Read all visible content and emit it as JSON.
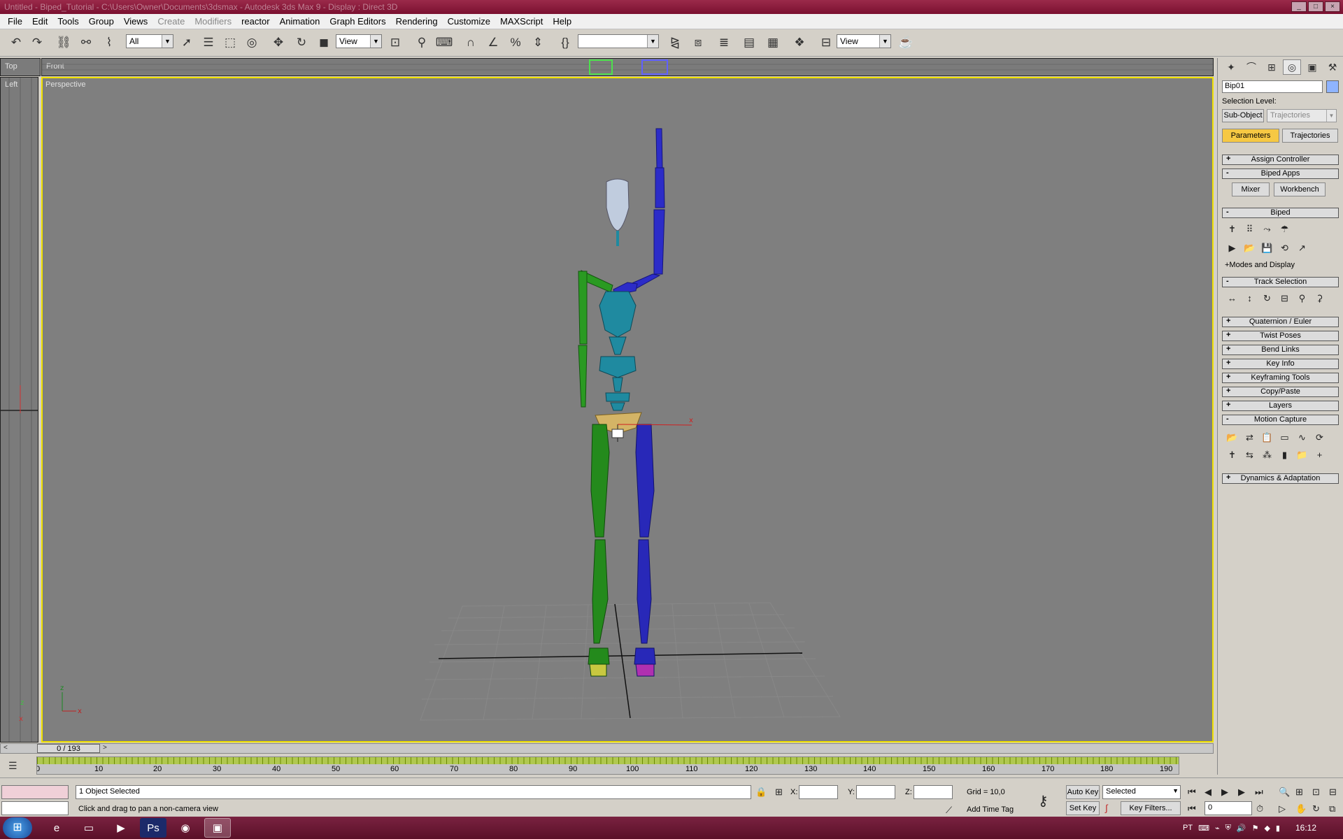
{
  "window": {
    "title": "Untitled - Biped_Tutorial - C:\\Users\\Owner\\Documents\\3dsmax - Autodesk 3ds Max 9 - Display : Direct 3D",
    "controls": [
      "_",
      "□",
      "×"
    ]
  },
  "menubar": {
    "items": [
      "File",
      "Edit",
      "Tools",
      "Group",
      "Views",
      "Create",
      "Modifiers",
      "reactor",
      "Animation",
      "Graph Editors",
      "Rendering",
      "Customize",
      "MAXScript",
      "Help"
    ]
  },
  "toolbar": {
    "selection_filter": "All",
    "reference_coord": "View",
    "named_selection": "",
    "render_view": "View"
  },
  "viewports": {
    "top_label": "Top",
    "front_label": "Front",
    "left_label": "Left",
    "perspective_label": "Perspective"
  },
  "command_panel": {
    "object_name": "Bip01",
    "selection_level_label": "Selection Level:",
    "sub_object_button": "Sub-Object",
    "sub_object_select": "Trajectories",
    "parameters_button": "Parameters",
    "trajectories_button": "Trajectories",
    "rollups": {
      "assign_controller": "Assign Controller",
      "biped_apps": "Biped Apps",
      "mixer": "Mixer",
      "workbench": "Workbench",
      "biped": "Biped",
      "modes_and_display": "+Modes and Display",
      "track_selection": "Track Selection",
      "quaternion_euler": "Quaternion / Euler",
      "twist_poses": "Twist Poses",
      "bend_links": "Bend Links",
      "key_info": "Key Info",
      "keyframing_tools": "Keyframing Tools",
      "copy_paste": "Copy/Paste",
      "layers": "Layers",
      "motion_capture": "Motion Capture",
      "dynamics_adaptation": "Dynamics & Adaptation"
    },
    "accent_color": "#f6c843"
  },
  "timeline": {
    "slider_text": "0 / 193",
    "ticks": [
      "0",
      "10",
      "20",
      "30",
      "40",
      "50",
      "60",
      "70",
      "80",
      "90",
      "100",
      "110",
      "120",
      "130",
      "140",
      "150",
      "160",
      "170",
      "180",
      "190"
    ]
  },
  "status": {
    "objects_selected": "1 Object Selected",
    "prompt": "Click and drag to pan a non-camera view",
    "x_label": "X:",
    "y_label": "Y:",
    "z_label": "Z:",
    "grid": "Grid = 10,0",
    "add_time_tag": "Add Time Tag",
    "auto_key": "Auto Key",
    "set_key": "Set Key",
    "selected_select": "Selected",
    "key_filters": "Key Filters...",
    "frame_value": "0"
  },
  "taskbar": {
    "language": "PT",
    "clock": "16:12"
  }
}
